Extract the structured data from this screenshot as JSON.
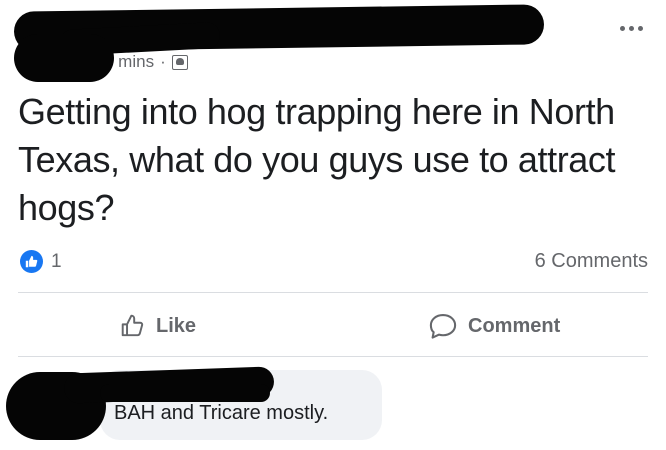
{
  "post": {
    "time": "7 mins",
    "separator": "·",
    "audience_icon": "friends-icon",
    "text": "Getting into hog trapping here in North Texas, what do you guys use to attract hogs?",
    "reaction_count": "1",
    "comments_label": "6 Comments"
  },
  "actions": {
    "like_label": "Like",
    "comment_label": "Comment"
  },
  "comment": {
    "text": "BAH and Tricare mostly."
  },
  "colors": {
    "accent": "#1877f2",
    "secondary_text": "#65676b",
    "bubble": "#f0f2f5",
    "redaction": "#050505"
  }
}
